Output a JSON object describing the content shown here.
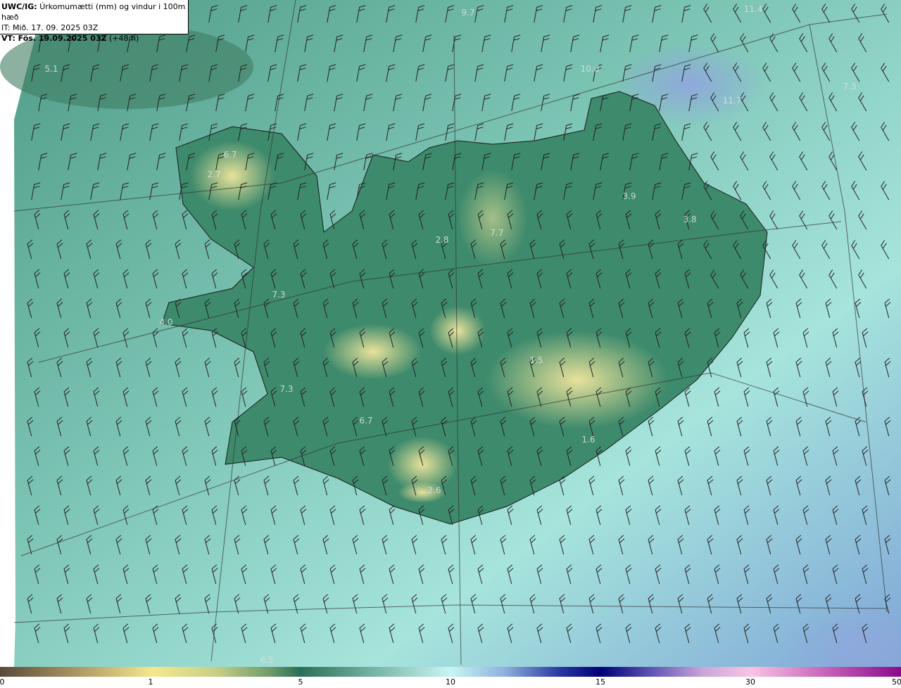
{
  "header": {
    "product": "UWC/IG:",
    "description": "Úrkomumætti (mm) og vindur i 100m hæð",
    "issue_time": "IT: Mið. 17. 09. 2025 03Z",
    "valid_prefix": "VT: Fös. 19.09.2025 03Z",
    "valid_suffix": "(+48 h)"
  },
  "map_labels": [
    "5.1",
    "6.7",
    "2.7",
    "2.8",
    "7.7",
    "3.9",
    "3.8",
    "7.3",
    "4.0",
    "7.3",
    "7.3",
    "6.7",
    "2.6",
    "6.5",
    "10.6",
    "11.7",
    "9.7",
    "11.4",
    "1.5",
    "1.6"
  ],
  "colorbar": {
    "ticks": [
      "0",
      "1",
      "5",
      "10",
      "15",
      "30",
      "50"
    ],
    "colors": [
      "#5a4a3a",
      "#f5e88e",
      "#2a6e58",
      "#c8f6f3",
      "#000077",
      "#f9c4e3",
      "#8a0a8a"
    ]
  }
}
